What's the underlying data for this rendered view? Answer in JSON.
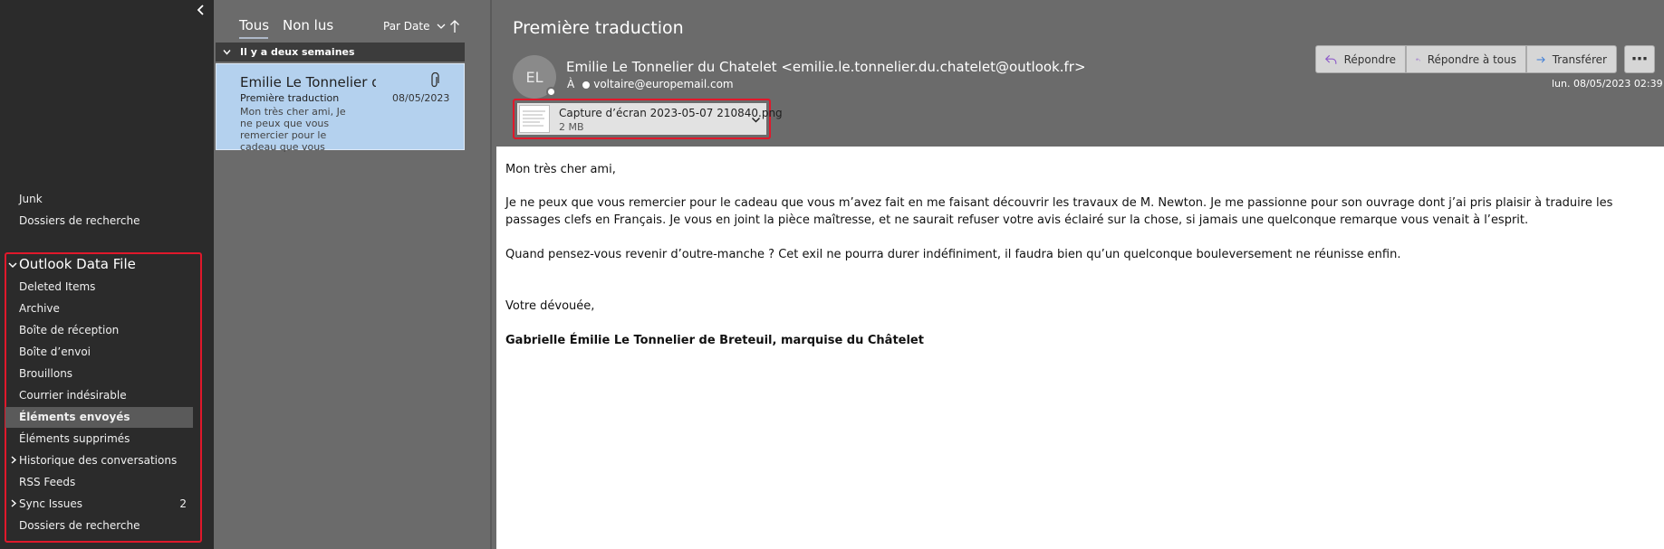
{
  "folders": {
    "top": [
      {
        "label": "Junk"
      },
      {
        "label": "Dossiers de recherche"
      }
    ],
    "datafile": {
      "title": "Outlook Data File",
      "items": [
        {
          "label": "Deleted Items"
        },
        {
          "label": "Archive"
        },
        {
          "label": "Boîte de réception"
        },
        {
          "label": "Boîte d’envoi"
        },
        {
          "label": "Brouillons"
        },
        {
          "label": "Courrier indésirable"
        },
        {
          "label": "Éléments envoyés"
        },
        {
          "label": "Éléments supprimés"
        },
        {
          "label": "Historique des conversations"
        },
        {
          "label": "RSS Feeds"
        },
        {
          "label": "Sync Issues",
          "count": "2"
        },
        {
          "label": "Dossiers de recherche"
        }
      ]
    }
  },
  "list": {
    "tabs": [
      {
        "label": "Tous"
      },
      {
        "label": "Non lus"
      }
    ],
    "sort_label": "Par Date",
    "group_label": "Il y a deux semaines",
    "item": {
      "sender": "Emilie Le Tonnelier du Chatelet",
      "subject": "Première traduction",
      "date": "08/05/2023",
      "preview": "Mon très cher ami, Je ne peux que vous remercier pour le cadeau que vous"
    }
  },
  "reading": {
    "title": "Première traduction",
    "avatar_initials": "EL",
    "from": "Emilie Le Tonnelier du Chatelet <emilie.le.tonnelier.du.chatelet@outlook.fr>",
    "to_label": "À",
    "to": "voltaire@europemail.com",
    "sent": "lun. 08/05/2023 02:39",
    "actions": {
      "reply": "Répondre",
      "reply_all": "Répondre à tous",
      "forward": "Transférer",
      "more": "⋯"
    },
    "attachment": {
      "name": "Capture d’écran 2023-05-07 210840.png",
      "size": "2 MB"
    },
    "body": {
      "greeting": "Mon très cher ami,",
      "para1": "Je ne peux que vous remercier pour le cadeau que vous m’avez fait en me faisant découvrir les travaux de M. Newton. Je me passionne pour son ouvrage dont j’ai pris plaisir à traduire les passages clefs en Français. Je vous en joint la pièce maîtresse, et ne saurait refuser votre avis éclairé sur la chose, si jamais une quelconque remarque vous venait à l’esprit.",
      "para2": "Quand pensez-vous revenir d’outre-manche ? Cet exil ne pourra durer indéfiniment, il faudra bien qu’un quelconque bouleversement ne réunisse enfin.",
      "closing": "Votre dévouée,",
      "signature": "Gabrielle Émilie Le Tonnelier de Breteuil, marquise du Châtelet"
    }
  },
  "colors": {
    "selection": "#b4d1ee",
    "highlight_border": "#e0182b",
    "pane_dark": "#2b2b2b",
    "pane_mid": "#6b6b6b"
  }
}
